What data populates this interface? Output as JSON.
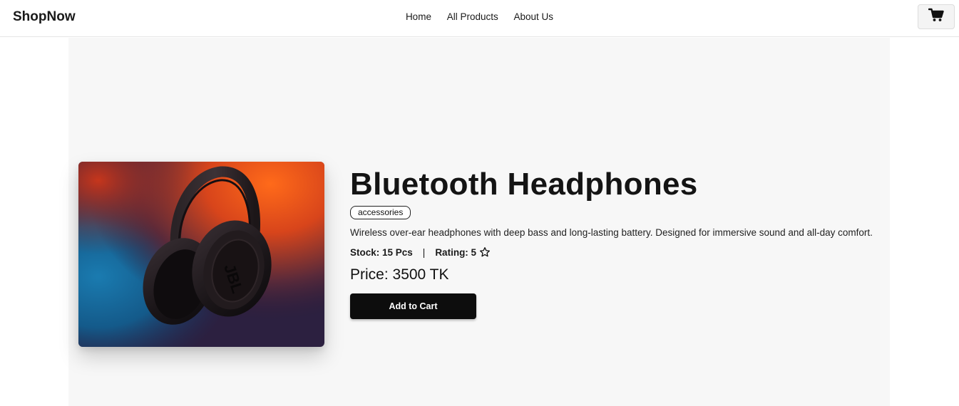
{
  "nav": {
    "brand": "ShopNow",
    "links": [
      "Home",
      "All Products",
      "About Us"
    ],
    "cart_icon": "shopping-cart-icon"
  },
  "product": {
    "title": "Bluetooth Headphones",
    "category": "accessories",
    "description": "Wireless over-ear headphones with deep bass and long-lasting battery. Designed for immersive sound and all-day comfort.",
    "stock_text": "Stock: 15 Pcs",
    "separator": "|",
    "rating_text": "Rating: 5",
    "rating_icon": "star-outline-icon",
    "price_text": "Price: 3500 TK",
    "add_to_cart_label": "Add to Cart",
    "image_logo_text": "JBL"
  },
  "colors": {
    "button_bg": "#0d0d0d",
    "page_bg": "#f7f7f7"
  }
}
